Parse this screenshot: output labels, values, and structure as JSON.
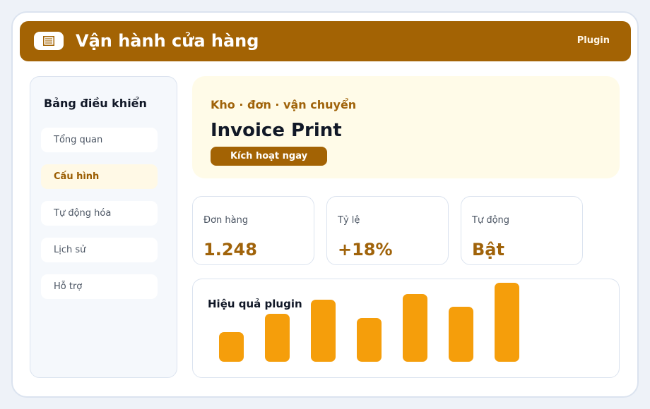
{
  "header": {
    "logo_icon": "document-list-icon",
    "title": "Vận hành cửa hàng",
    "plugin_label": "Plugin"
  },
  "sidebar": {
    "title": "Bảng điều khiển",
    "items": [
      {
        "label": "Tổng quan",
        "active": false
      },
      {
        "label": "Cấu hình",
        "active": true
      },
      {
        "label": "Tự động hóa",
        "active": false
      },
      {
        "label": "Lịch sử",
        "active": false
      },
      {
        "label": "Hỗ trợ",
        "active": false
      }
    ]
  },
  "hero": {
    "kicker": "Kho · đơn · vận chuyển",
    "title": "Invoice Print",
    "button_label": "Kích hoạt ngay"
  },
  "stats": [
    {
      "label": "Đơn hàng",
      "value": "1.248"
    },
    {
      "label": "Tỷ lệ",
      "value": "+18%"
    },
    {
      "label": "Tự động",
      "value": "Bật"
    }
  ],
  "chart": {
    "title": "Hiệu quả plugin"
  },
  "chart_data": {
    "type": "bar",
    "title": "Hiệu quả plugin",
    "values": [
      42,
      68,
      88,
      62,
      96,
      78,
      112
    ],
    "ylim": [
      0,
      112
    ]
  },
  "colors": {
    "brand": "#a36304",
    "accent_text": "#a0630a",
    "bar": "#f59e0b",
    "hero_bg": "#fffbe8",
    "active_nav_bg": "#fff9e6"
  }
}
